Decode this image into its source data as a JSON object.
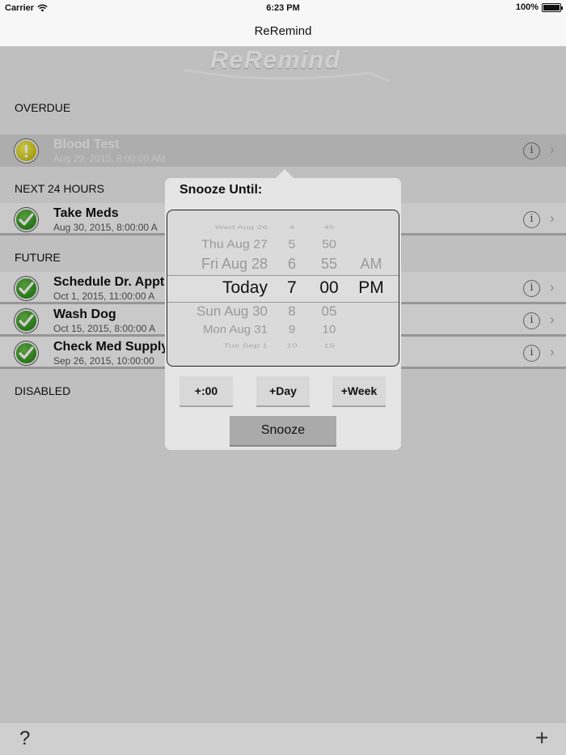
{
  "status_bar": {
    "carrier": "Carrier",
    "time": "6:23 PM",
    "battery": "100%"
  },
  "nav": {
    "title": "ReRemind"
  },
  "logo": {
    "text": "ReRemind"
  },
  "sections": {
    "overdue": "OVERDUE",
    "next24": "NEXT 24 HOURS",
    "future": "FUTURE",
    "disabled": "DISABLED"
  },
  "reminders": [
    {
      "title": "Blood Test",
      "subtitle": "Aug 29, 2015, 8:00:00 AM",
      "status": "overdue"
    },
    {
      "title": "Take Meds",
      "subtitle": "Aug 30, 2015, 8:00:00 A",
      "status": "ok"
    },
    {
      "title": "Schedule Dr. Appt",
      "subtitle": "Oct 1, 2015, 11:00:00 A",
      "status": "ok"
    },
    {
      "title": "Wash Dog",
      "subtitle": "Oct 15, 2015, 8:00:00 A",
      "status": "ok"
    },
    {
      "title": "Check Med Supply",
      "subtitle": "Sep 26, 2015, 10:00:00",
      "status": "ok"
    }
  ],
  "popover": {
    "title": "Snooze Until:",
    "picker": {
      "dates": [
        "Wed Aug 26",
        "Thu Aug 27",
        "Fri Aug 28",
        "Today",
        "Sun Aug 30",
        "Mon Aug 31",
        "Tue Sep 1"
      ],
      "hours": [
        "4",
        "5",
        "6",
        "7",
        "8",
        "9",
        "10"
      ],
      "minutes": [
        "45",
        "50",
        "55",
        "00",
        "05",
        "10",
        "15"
      ],
      "ampm": [
        "AM",
        "PM"
      ]
    },
    "buttons": {
      "plus_zero": "+:00",
      "plus_day": "+Day",
      "plus_week": "+Week"
    },
    "snooze_label": "Snooze"
  },
  "toolbar": {
    "help": "?",
    "add": "+"
  },
  "info_glyph": "i",
  "chevron_glyph": "›",
  "colors": {
    "ok_green": "#2f8f1f",
    "warn_yellow": "#c9c316",
    "dim_overlay": "rgba(0,0,0,0.18)"
  }
}
